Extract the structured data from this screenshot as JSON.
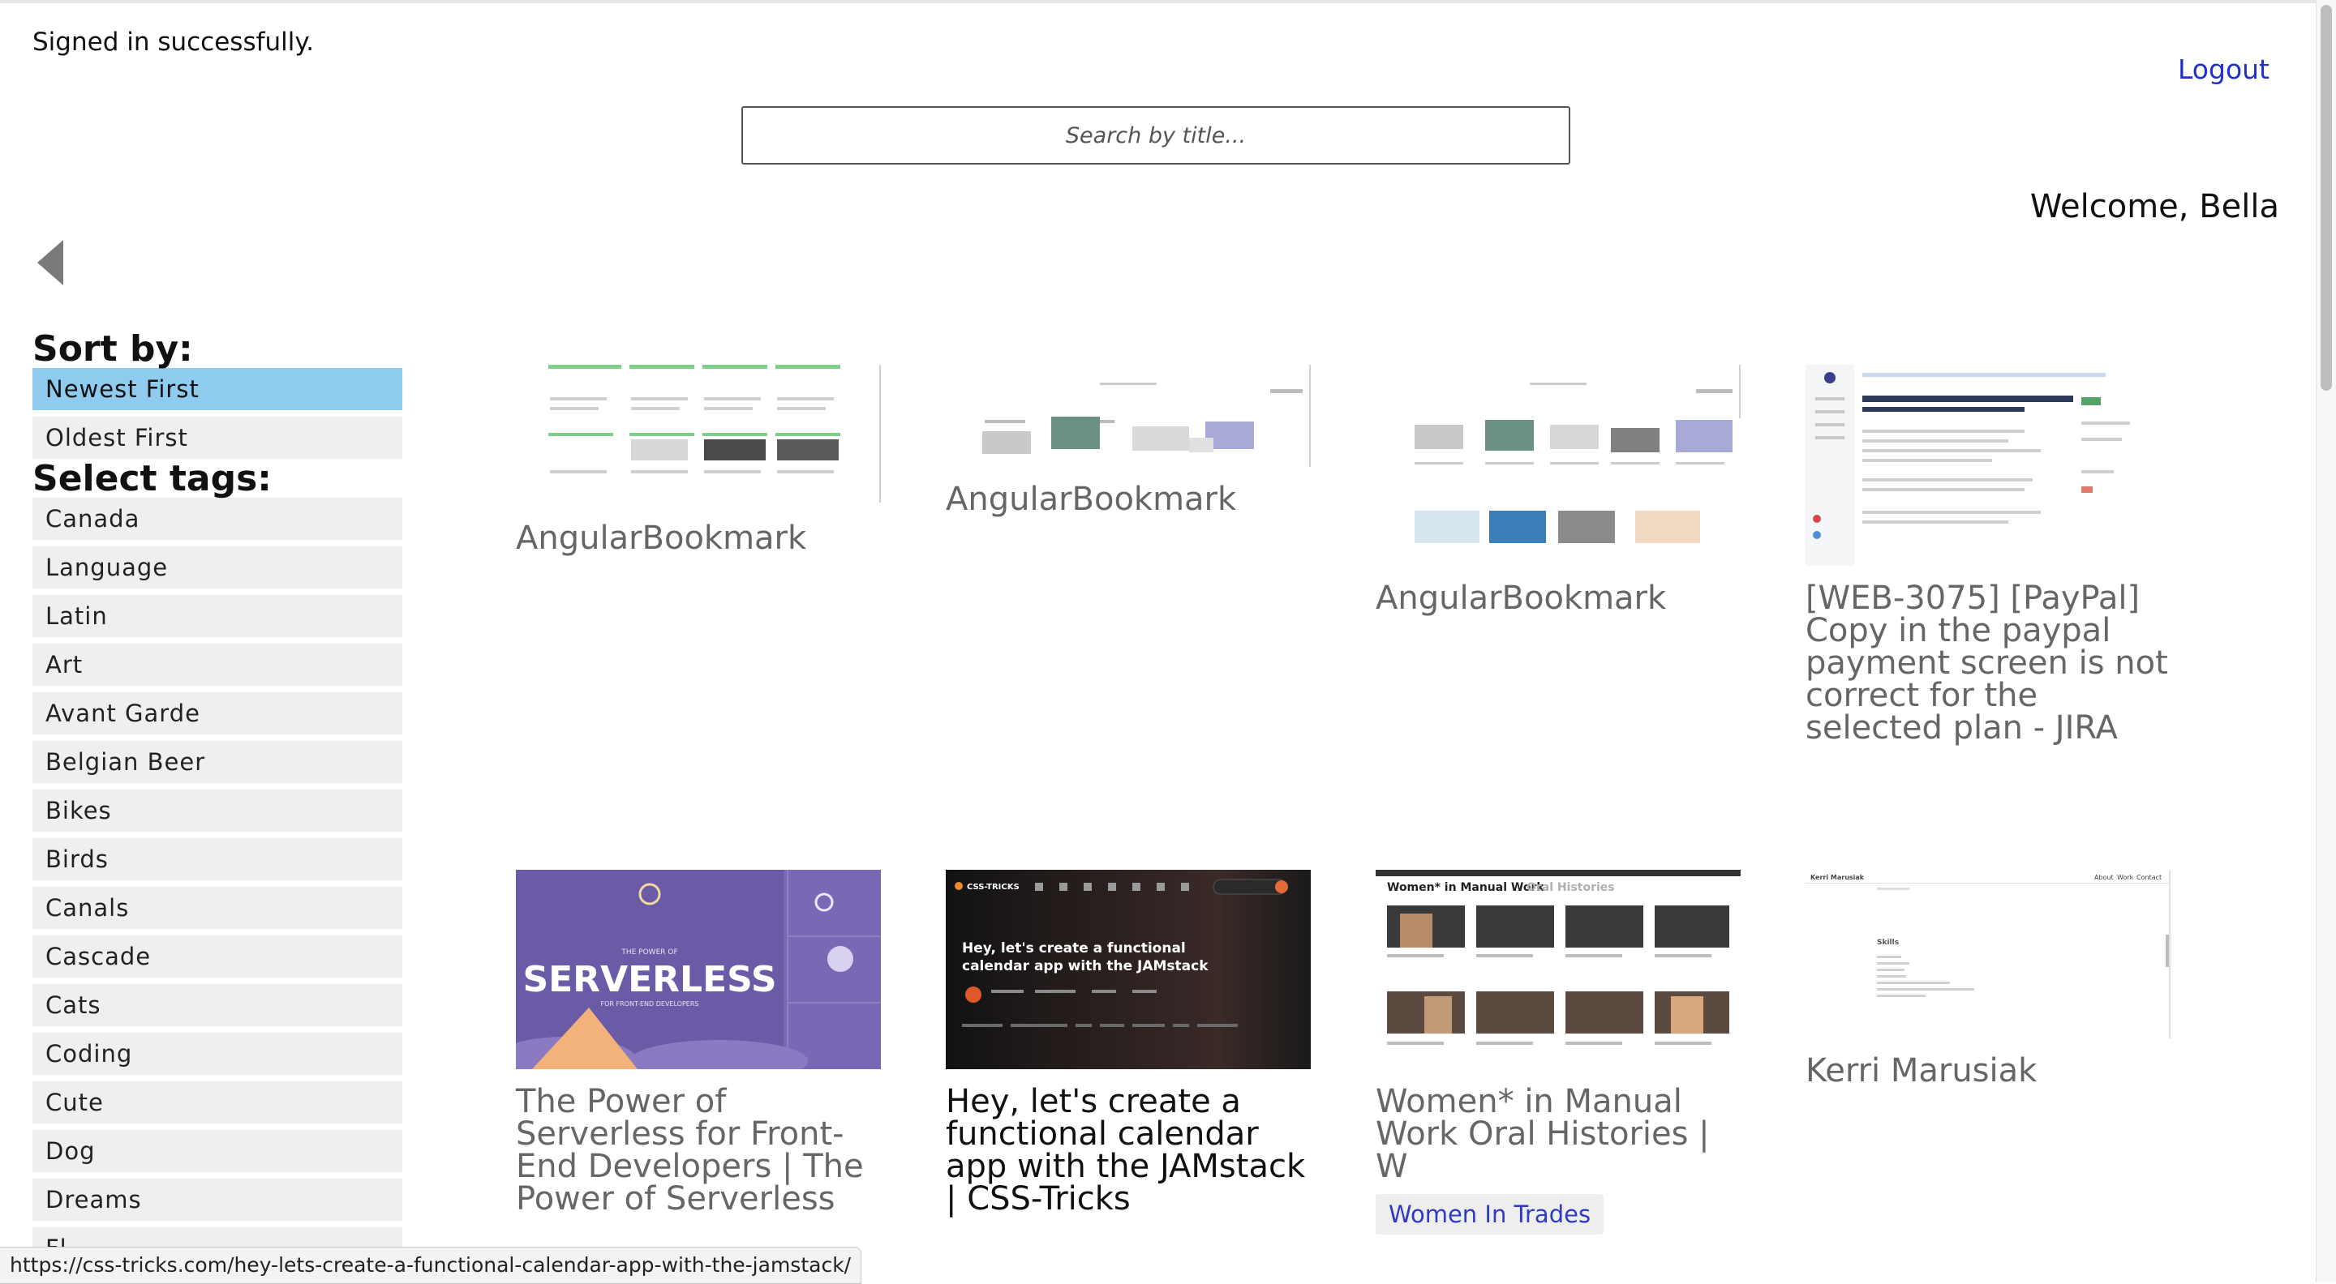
{
  "flash": "Signed in successfully.",
  "header": {
    "logout": "Logout",
    "search_placeholder": "Search by title...",
    "welcome": "Welcome, Bella"
  },
  "sidebar": {
    "sort_label": "Sort by:",
    "sort_options": [
      "Newest First",
      "Oldest First"
    ],
    "sort_selected": "Newest First",
    "tags_label": "Select tags:",
    "tags": [
      "Canada",
      "Language",
      "Latin",
      "Art",
      "Avant Garde",
      "Belgian Beer",
      "Bikes",
      "Birds",
      "Canals",
      "Cascade",
      "Cats",
      "Coding",
      "Cute",
      "Dog",
      "Dreams",
      "Fl"
    ]
  },
  "bookmarks": [
    {
      "title": "AngularBookmark",
      "thumb": "grid-of-green-cards-screenshot",
      "tags": []
    },
    {
      "title": "AngularBookmark",
      "thumb": "small-bookmark-list-screenshot",
      "tags": []
    },
    {
      "title": "AngularBookmark",
      "thumb": "bookmark-grid-screenshot",
      "tags": []
    },
    {
      "title": "[WEB-3075] [PayPal] Copy in the paypal payment screen is not correct for the selected plan - JIRA",
      "thumb": "jira-issue-screenshot",
      "tags": []
    },
    {
      "title": "The Power of Serverless for Front-End Developers | The Power of Serverless",
      "thumb": "serverless-course-banner",
      "tags": []
    },
    {
      "title": "Hey, let's create a functional calendar app with the JAMstack | CSS-Tricks",
      "thumb": "css-tricks-article-header",
      "tags": []
    },
    {
      "title": "Women* in Manual Work Oral Histories | W",
      "thumb": "oral-histories-video-grid",
      "tags": [
        "Women In Trades"
      ]
    },
    {
      "title": "Kerri Marusiak",
      "thumb": "portfolio-page-screenshot",
      "tags": []
    }
  ],
  "thumb_text": {
    "serverless": "SERVERLESS",
    "serverless_kicker": "THE POWER OF",
    "serverless_sub": "FOR FRONT-END DEVELOPERS",
    "csstricks_brand": "CSS-TRICKS",
    "csstricks_headline_1": "Hey, let's create a functional",
    "csstricks_headline_2": "calendar app with the JAMstack",
    "women_header": "Women* in Manual Work",
    "women_header_accent": "Oral Histories",
    "kerri_name": "Kerri Marusiak",
    "kerri_nav": [
      "About",
      "Work",
      "Contact"
    ],
    "kerri_skills": "Skills"
  },
  "status_url": "https://css-tricks.com/hey-lets-create-a-functional-calendar-app-with-the-jamstack/",
  "colors": {
    "sort_active": "#8ecbef",
    "link": "#2030c8",
    "tag_text": "#2f3ac2"
  }
}
